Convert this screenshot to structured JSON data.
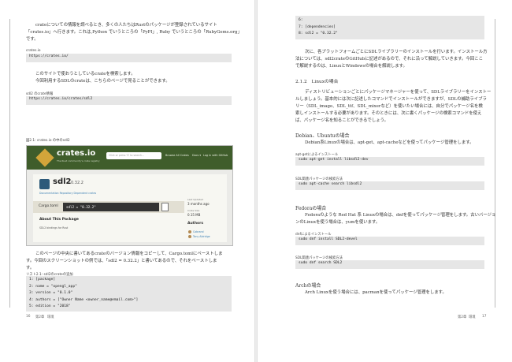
{
  "left": {
    "intro1": "crateについての情報を調べるとき、多くの人たちはRustのパッケージが登録されているサイト",
    "intro2": "「crates.io」へ行きます。これは,Python でいうところの「PyPI」, Ruby でいうところの「RubyGems.org」",
    "intro3": "です。",
    "cap1": "crates.io",
    "code1": "https://crates.io/",
    "p2a": "このサイトで使おうとしているcrateを検索します。",
    "p2b": "今回利用するSDLのcrateは、こちらのページで見ることができます。",
    "cap2": "sdl2 のcrate情報",
    "code2": "https://crates.io/crates/sdl2",
    "figcap": "図2.1: crates.io の中のsdl2",
    "p3a": "このページの中央に書いてあるcrateのバージョン情報をコピーして、Cargo.tomlにペーストしま",
    "p3b": "す。今回のスクリーンショットの例では、「sdl2 = 0.32.2」と書いてあるので、それをペーストしま",
    "p3c": "す。",
    "listcap": "リスト2.1: sdl2のcrateの追加",
    "list": [
      "1: [package]",
      "2: name = \"opengl_app\"",
      "3: version = \"0.1.0\"",
      "4: authors = [\"Owner Name <owner_name@email.com>\"]",
      "5: edition = \"2018\""
    ],
    "folio_num": "16",
    "folio_chap": "第2章",
    "folio_title": "環境",
    "shot": {
      "logo": "crates.io",
      "tagline": "The Rust community's crate registry",
      "search_placeholder": "Click or press 'S' to search...",
      "nav1": "Browse All Crates",
      "nav2": "Docs ▾",
      "nav3": "Log in with GitHub",
      "crate_name": "sdl2",
      "crate_version": "0.32.2",
      "links": "Documentation   Repository   Dependent crates",
      "cargo_label": "Cargo.toml",
      "cargo_value": "sdl2 = \"0.32.2\"",
      "about": "About This Package",
      "desc": "SDL2 bindings for Rust",
      "last_updated_label": "Last Updated",
      "last_updated": "3 months ago",
      "crate_size_label": "Crate Size",
      "crate_size": "0.15 MB",
      "authors": "Authors",
      "author1": "Cobrand",
      "author2": "Tony Aldridge"
    }
  },
  "right": {
    "code_top": [
      "6:",
      "7: [dependencies]",
      "8: sdl2 = \"0.32.2\""
    ],
    "p1a": "次に、各プラットフォームごとにSDLライブラリーのインストールを行います。インストール方",
    "p1b": "法については、sdl2crateのGitHubに記述があるので、それに沿って解説していきます。今回ここ",
    "p1c": "で解説するのは、LinuxとWindowsの場合を解説します。",
    "h": "2.1.2　Linuxの場合",
    "p2a": "ディストリビューションごとにパッケージマネージャーを使って、SDLライブラリーをインストー",
    "p2b": "ルしましょう。基本的には次に記述したコマンドでインストールができますが、SDLの補助ライブラ",
    "p2c": "リー（SDL_image、SDL_ttf、SDL_mixerなど）を使いたい場合には、自分でパッケージ名を検",
    "p2d": "索しインストールする必要があります。そのときには、次に書くパッケージの検索コマンドを使え",
    "p2e": "ば、パッケージ名を知ることができるでしょう。",
    "deb_h": "Debian、Ubuntuの場合",
    "deb_p": "Debian系Linuxの場合は、apt-get、apt-cacheなどを使ってパッケージ管理をします。",
    "cap_a": "apt-getによるインストール",
    "code_a": "sudo apt-get install libsdl2-dev",
    "cap_b": "SDL関連パッケージの検索方法",
    "code_b": "sudo apt-cache search libsdl2",
    "fed_h": "Fedoraの場合",
    "fed_p1": "Fedoraのような Red Hat 系 Linuxの場合は、dnfを使ってパッケージ管理をします。古いバージョ",
    "fed_p2": "ンのLinuxを使う場合は、yumを使います。",
    "cap_c": "dnfによるインストール",
    "code_c": "sudo dnf install SDL2-devel",
    "cap_d": "SDL関連パッケージの検索方法",
    "code_d": "sudo dnf search SDL2",
    "arch_h": "Archの場合",
    "arch_p": "Arch Linuxを使う場合には、pacmanを使ってパッケージ管理をします。",
    "folio_chap": "第2章",
    "folio_title": "環境",
    "folio_num": "17"
  }
}
